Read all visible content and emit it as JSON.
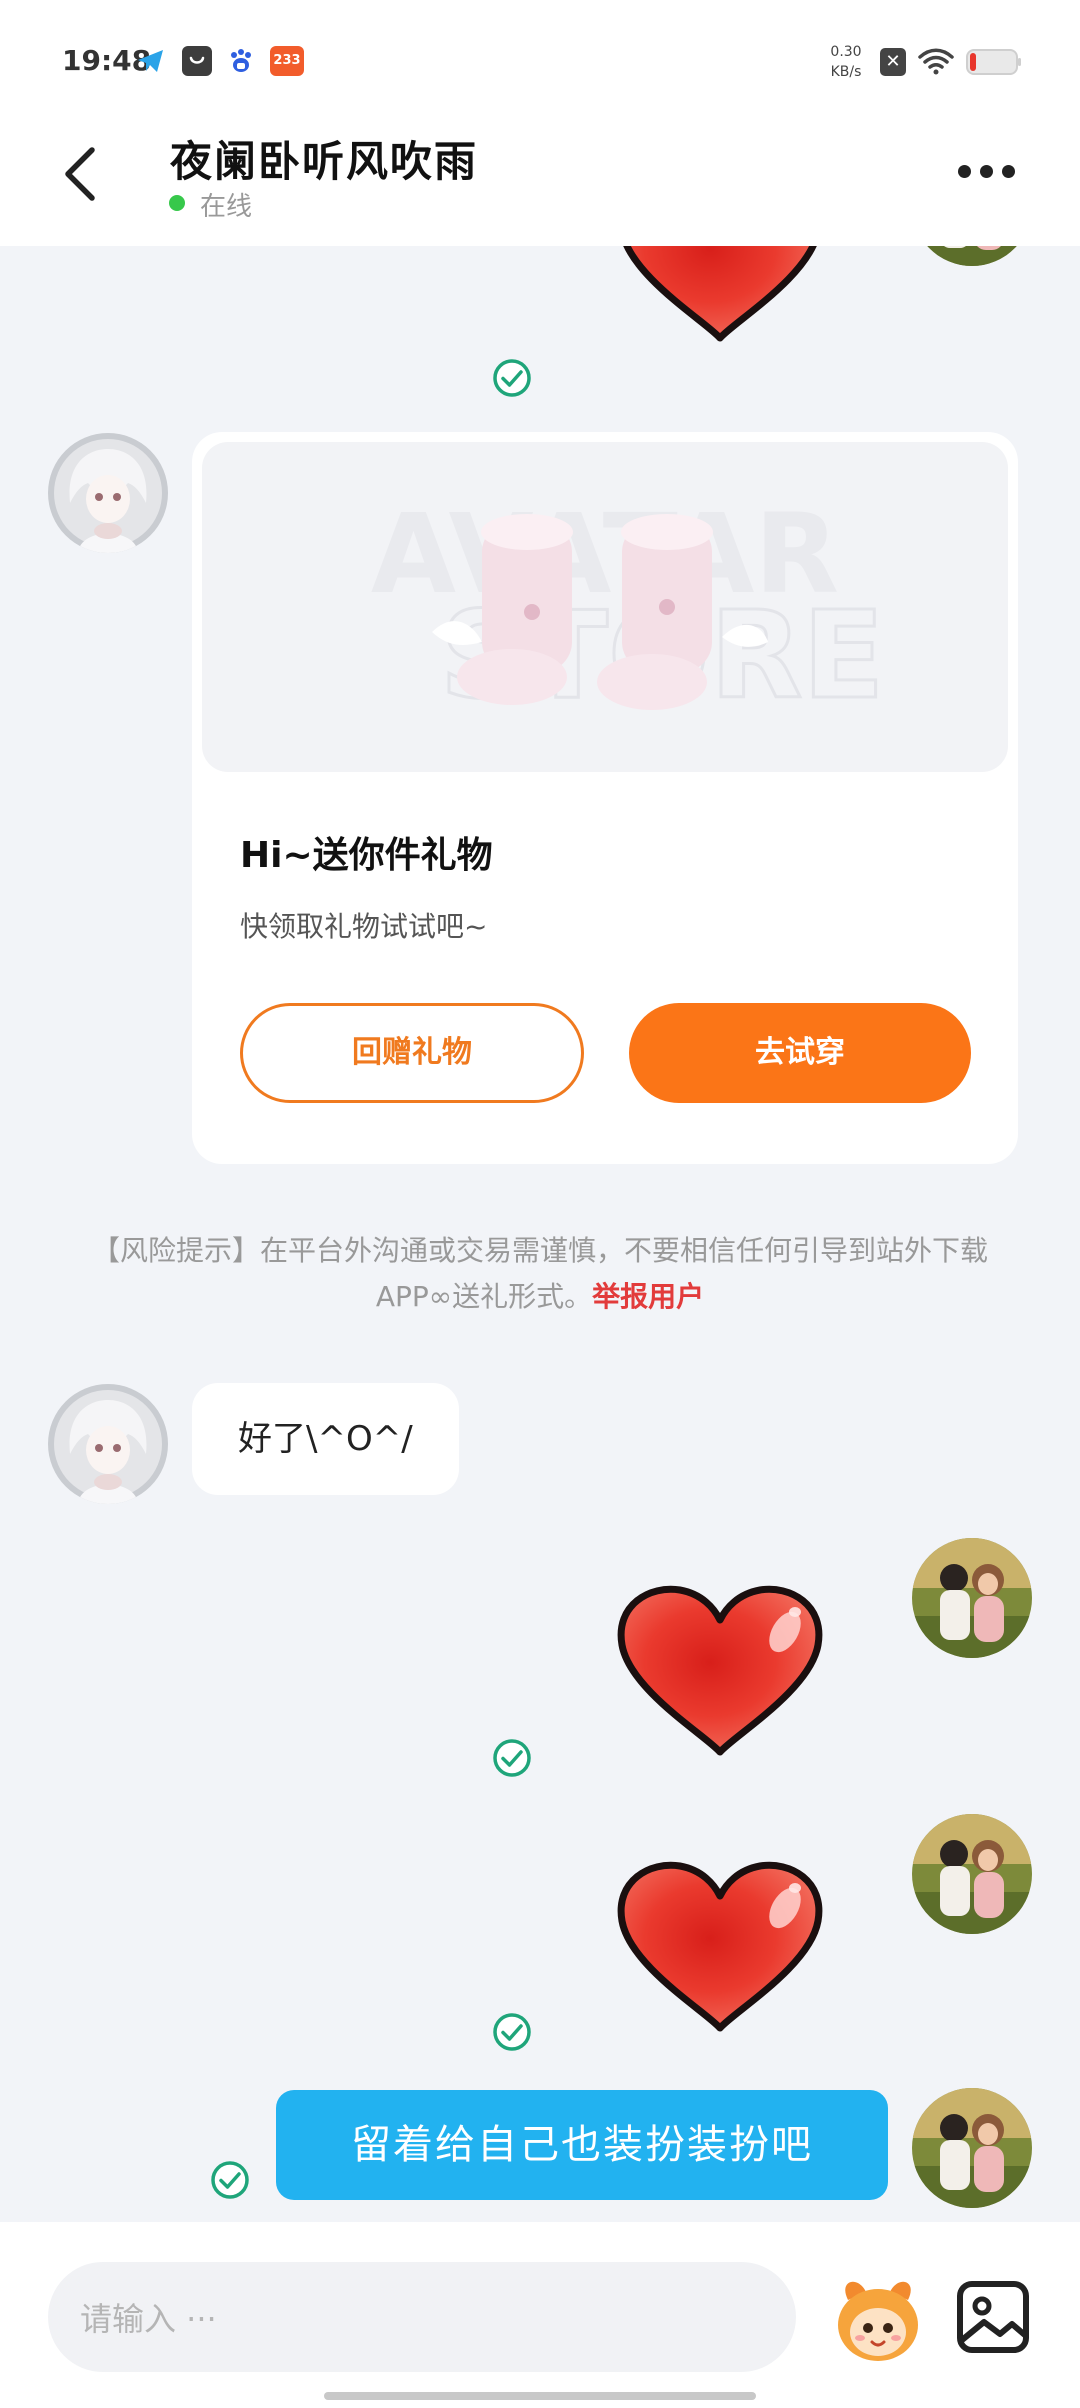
{
  "status_bar": {
    "time": "19:48",
    "app_icons": [
      "telegram-icon",
      "shopping-bag-icon",
      "baidu-paw-icon"
    ],
    "badge_text": "233",
    "net_speed_value": "0.30",
    "net_speed_unit": "KB/s"
  },
  "header": {
    "title": "夜阑卧听风吹雨",
    "status": "在线"
  },
  "gift_card": {
    "watermark_line1": "AVATAR",
    "watermark_line2": "STORE",
    "title": "Hi~送你件礼物",
    "subtitle": "快领取礼物试试吧~",
    "return_gift_label": "回赠礼物",
    "try_on_label": "去试穿"
  },
  "risk_notice": {
    "text": "【风险提示】在平台外沟通或交易需谨慎，不要相信任何引导到站外下载APP∞送礼形式。",
    "report_label": "举报用户"
  },
  "messages": {
    "incoming_text": "好了\\^O^/",
    "outgoing_text": "留着给自己也装扮装扮吧"
  },
  "input": {
    "placeholder": "请输入 ···"
  },
  "colors": {
    "accent_orange": "#fb7517",
    "bubble_blue": "#22b2f0",
    "online_green": "#37c84b",
    "report_red": "#e23b3b",
    "check_green": "#1fa57a",
    "heart_red": "#e8362c"
  }
}
